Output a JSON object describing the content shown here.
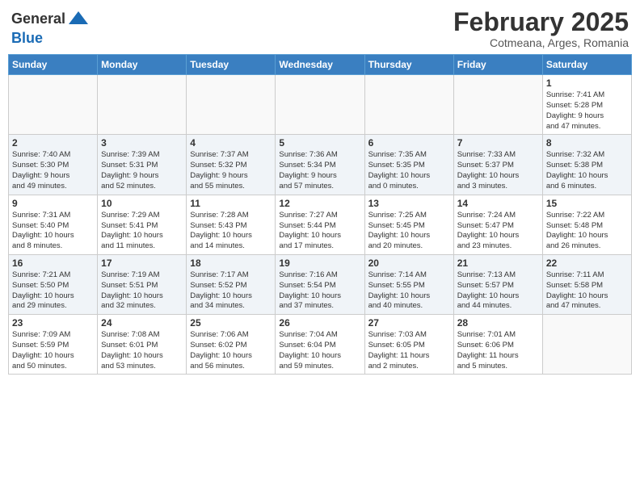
{
  "header": {
    "logo_line1": "General",
    "logo_line2": "Blue",
    "month_year": "February 2025",
    "location": "Cotmeana, Arges, Romania"
  },
  "weekdays": [
    "Sunday",
    "Monday",
    "Tuesday",
    "Wednesday",
    "Thursday",
    "Friday",
    "Saturday"
  ],
  "weeks": [
    {
      "shaded": false,
      "days": [
        {
          "num": "",
          "info": ""
        },
        {
          "num": "",
          "info": ""
        },
        {
          "num": "",
          "info": ""
        },
        {
          "num": "",
          "info": ""
        },
        {
          "num": "",
          "info": ""
        },
        {
          "num": "",
          "info": ""
        },
        {
          "num": "1",
          "info": "Sunrise: 7:41 AM\nSunset: 5:28 PM\nDaylight: 9 hours\nand 47 minutes."
        }
      ]
    },
    {
      "shaded": true,
      "days": [
        {
          "num": "2",
          "info": "Sunrise: 7:40 AM\nSunset: 5:30 PM\nDaylight: 9 hours\nand 49 minutes."
        },
        {
          "num": "3",
          "info": "Sunrise: 7:39 AM\nSunset: 5:31 PM\nDaylight: 9 hours\nand 52 minutes."
        },
        {
          "num": "4",
          "info": "Sunrise: 7:37 AM\nSunset: 5:32 PM\nDaylight: 9 hours\nand 55 minutes."
        },
        {
          "num": "5",
          "info": "Sunrise: 7:36 AM\nSunset: 5:34 PM\nDaylight: 9 hours\nand 57 minutes."
        },
        {
          "num": "6",
          "info": "Sunrise: 7:35 AM\nSunset: 5:35 PM\nDaylight: 10 hours\nand 0 minutes."
        },
        {
          "num": "7",
          "info": "Sunrise: 7:33 AM\nSunset: 5:37 PM\nDaylight: 10 hours\nand 3 minutes."
        },
        {
          "num": "8",
          "info": "Sunrise: 7:32 AM\nSunset: 5:38 PM\nDaylight: 10 hours\nand 6 minutes."
        }
      ]
    },
    {
      "shaded": false,
      "days": [
        {
          "num": "9",
          "info": "Sunrise: 7:31 AM\nSunset: 5:40 PM\nDaylight: 10 hours\nand 8 minutes."
        },
        {
          "num": "10",
          "info": "Sunrise: 7:29 AM\nSunset: 5:41 PM\nDaylight: 10 hours\nand 11 minutes."
        },
        {
          "num": "11",
          "info": "Sunrise: 7:28 AM\nSunset: 5:43 PM\nDaylight: 10 hours\nand 14 minutes."
        },
        {
          "num": "12",
          "info": "Sunrise: 7:27 AM\nSunset: 5:44 PM\nDaylight: 10 hours\nand 17 minutes."
        },
        {
          "num": "13",
          "info": "Sunrise: 7:25 AM\nSunset: 5:45 PM\nDaylight: 10 hours\nand 20 minutes."
        },
        {
          "num": "14",
          "info": "Sunrise: 7:24 AM\nSunset: 5:47 PM\nDaylight: 10 hours\nand 23 minutes."
        },
        {
          "num": "15",
          "info": "Sunrise: 7:22 AM\nSunset: 5:48 PM\nDaylight: 10 hours\nand 26 minutes."
        }
      ]
    },
    {
      "shaded": true,
      "days": [
        {
          "num": "16",
          "info": "Sunrise: 7:21 AM\nSunset: 5:50 PM\nDaylight: 10 hours\nand 29 minutes."
        },
        {
          "num": "17",
          "info": "Sunrise: 7:19 AM\nSunset: 5:51 PM\nDaylight: 10 hours\nand 32 minutes."
        },
        {
          "num": "18",
          "info": "Sunrise: 7:17 AM\nSunset: 5:52 PM\nDaylight: 10 hours\nand 34 minutes."
        },
        {
          "num": "19",
          "info": "Sunrise: 7:16 AM\nSunset: 5:54 PM\nDaylight: 10 hours\nand 37 minutes."
        },
        {
          "num": "20",
          "info": "Sunrise: 7:14 AM\nSunset: 5:55 PM\nDaylight: 10 hours\nand 40 minutes."
        },
        {
          "num": "21",
          "info": "Sunrise: 7:13 AM\nSunset: 5:57 PM\nDaylight: 10 hours\nand 44 minutes."
        },
        {
          "num": "22",
          "info": "Sunrise: 7:11 AM\nSunset: 5:58 PM\nDaylight: 10 hours\nand 47 minutes."
        }
      ]
    },
    {
      "shaded": false,
      "days": [
        {
          "num": "23",
          "info": "Sunrise: 7:09 AM\nSunset: 5:59 PM\nDaylight: 10 hours\nand 50 minutes."
        },
        {
          "num": "24",
          "info": "Sunrise: 7:08 AM\nSunset: 6:01 PM\nDaylight: 10 hours\nand 53 minutes."
        },
        {
          "num": "25",
          "info": "Sunrise: 7:06 AM\nSunset: 6:02 PM\nDaylight: 10 hours\nand 56 minutes."
        },
        {
          "num": "26",
          "info": "Sunrise: 7:04 AM\nSunset: 6:04 PM\nDaylight: 10 hours\nand 59 minutes."
        },
        {
          "num": "27",
          "info": "Sunrise: 7:03 AM\nSunset: 6:05 PM\nDaylight: 11 hours\nand 2 minutes."
        },
        {
          "num": "28",
          "info": "Sunrise: 7:01 AM\nSunset: 6:06 PM\nDaylight: 11 hours\nand 5 minutes."
        },
        {
          "num": "",
          "info": ""
        }
      ]
    }
  ]
}
